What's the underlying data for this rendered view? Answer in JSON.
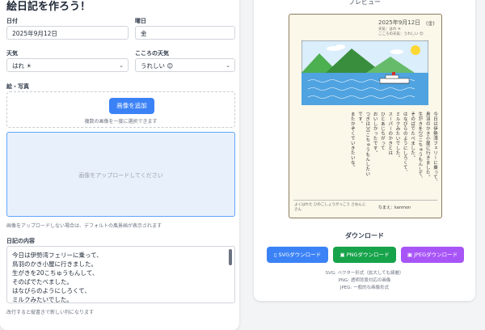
{
  "form": {
    "title": "絵日記を作ろう！",
    "date_label": "日付",
    "date_value": "2025年9月12日",
    "weekday_label": "曜日",
    "weekday_value": "金",
    "weather_label": "天気",
    "weather_value": "はれ ☀",
    "mood_label": "こころの天気",
    "mood_value": "うれしい 😊",
    "picture_label": "絵・写真",
    "add_image_button": "画像を追加",
    "multi_select_hint": "複数の画像を一度に選択できます",
    "upload_placeholder": "画像をアップロードしてください",
    "default_image_note": "画像をアップロードしない場合は、デフォルトの風景画が表示されます",
    "diary_label": "日記の内容",
    "diary_lines": [
      "今日は伊勢湾フェリーに乗って、",
      "鳥羽のかき小屋に行きました。",
      "生がきを20こちゅうもんして、",
      "そのばでたべました。",
      "はなびらのようにしろくて、",
      "ミルクみたいでした。"
    ],
    "newline_hint": "改行すると縦書きで新しい列になります"
  },
  "preview": {
    "title": "プレビュー",
    "diary_date": "2025年9月12日",
    "diary_weekday": "(金)",
    "diary_weather": "天気：はれ ☀",
    "diary_mood": "こころの天気：うれしい 😊",
    "diary_columns": [
      "今日は伊勢湾フェリーに乗って、",
      "鳥羽のかき小屋に行きました。",
      "生がきを20こちゅうもんして、",
      "そのばでたべました。",
      "はなびらのようにしろくて、",
      "ミルクみたいでした。",
      "スーパーのかきとは",
      "ひとあじちがって",
      "おいしかったです。",
      "つぎは30こちゅうもんしたい",
      "です。",
      "またかぞくでいきたいな。"
    ],
    "footer_left": "よくはれた ひのこしょうがっこう さおんじさん",
    "footer_right": "なまえ：kanmon"
  },
  "download": {
    "title": "ダウンロード",
    "svg_button": "SVGダウンロード",
    "png_button": "PNGダウンロード",
    "jpeg_button": "JPEGダウンロード",
    "svg_note": "SVG: ベクター形式（拡大しても綺麗）",
    "png_note": "PNG: 透明背景対応の画像",
    "jpeg_note": "JPEG: 一般的な画像形式"
  },
  "colors": {
    "accent_blue": "#3b82f6",
    "png_green": "#16a34a",
    "jpeg_purple": "#a855f7"
  },
  "icons": [
    "chevron-down-icon",
    "file-icon",
    "image-icon",
    "sun-icon",
    "ferry-icon"
  ]
}
